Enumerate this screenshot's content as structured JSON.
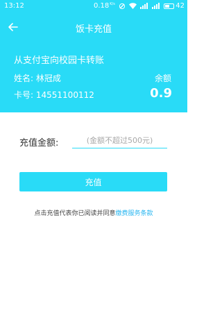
{
  "status_bar": {
    "time": "13:12",
    "network_speed": "0.18",
    "network_speed_unit": "K/s",
    "battery": "42"
  },
  "nav": {
    "title": "饭卡充值"
  },
  "card_info": {
    "transfer_title": "从支付宝向校园卡转账",
    "name_label": "姓名:",
    "name_value": "林冠成",
    "card_label": "卡号:",
    "card_value": "14551100112",
    "balance_label": "余额",
    "balance_value": "0.9"
  },
  "form": {
    "amount_label": "充值金额:",
    "amount_placeholder": "(金额不超过500元)",
    "amount_value": "",
    "recharge_label": "充值"
  },
  "agreement": {
    "prefix": "点击充值代表你已阅读并同意",
    "link": "缴费服务条款"
  },
  "colors": {
    "accent": "#29dbf7",
    "link": "#29b6f0",
    "text_dark": "#333333",
    "placeholder": "#a8a8a8"
  }
}
